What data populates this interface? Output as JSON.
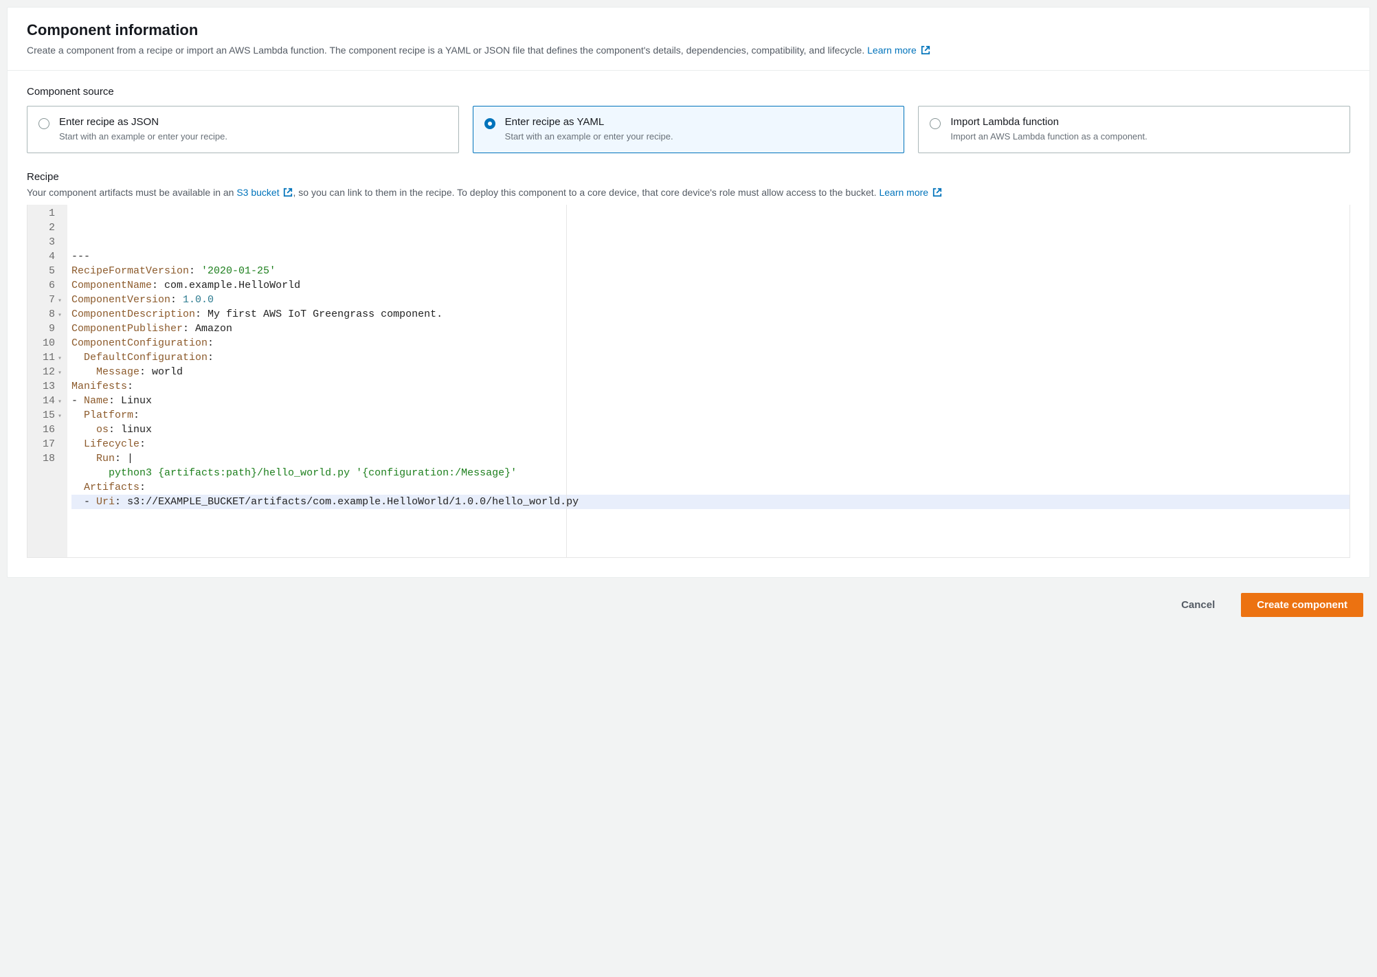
{
  "header": {
    "title": "Component information",
    "desc_part1": "Create a component from a recipe or import an AWS Lambda function. The component recipe is a YAML or JSON file that defines the component's details, dependencies, compatibility, and lifecycle. ",
    "learn_more": "Learn more"
  },
  "source": {
    "label": "Component source",
    "options": [
      {
        "id": "json",
        "title": "Enter recipe as JSON",
        "desc": "Start with an example or enter your recipe.",
        "selected": false
      },
      {
        "id": "yaml",
        "title": "Enter recipe as YAML",
        "desc": "Start with an example or enter your recipe.",
        "selected": true
      },
      {
        "id": "lambda",
        "title": "Import Lambda function",
        "desc": "Import an AWS Lambda function as a component.",
        "selected": false
      }
    ]
  },
  "recipe": {
    "label": "Recipe",
    "helper_pre": "Your component artifacts must be available in an ",
    "s3_link": "S3 bucket",
    "helper_mid": ", so you can link to them in the recipe. To deploy this component to a core device, that core device's role must allow access to the bucket. ",
    "learn_more": "Learn more",
    "lines": [
      {
        "n": "1",
        "fold": "",
        "tokens": [
          [
            "punct",
            "---"
          ]
        ]
      },
      {
        "n": "2",
        "fold": "",
        "tokens": [
          [
            "key",
            "RecipeFormatVersion"
          ],
          [
            "punct",
            ": "
          ],
          [
            "str",
            "'2020-01-25'"
          ]
        ]
      },
      {
        "n": "3",
        "fold": "",
        "tokens": [
          [
            "key",
            "ComponentName"
          ],
          [
            "punct",
            ": "
          ],
          [
            "plain",
            "com.example.HelloWorld"
          ]
        ]
      },
      {
        "n": "4",
        "fold": "",
        "tokens": [
          [
            "key",
            "ComponentVersion"
          ],
          [
            "punct",
            ": "
          ],
          [
            "num",
            "1.0.0"
          ]
        ]
      },
      {
        "n": "5",
        "fold": "",
        "tokens": [
          [
            "key",
            "ComponentDescription"
          ],
          [
            "punct",
            ": "
          ],
          [
            "plain",
            "My first AWS IoT Greengrass component."
          ]
        ]
      },
      {
        "n": "6",
        "fold": "",
        "tokens": [
          [
            "key",
            "ComponentPublisher"
          ],
          [
            "punct",
            ": "
          ],
          [
            "plain",
            "Amazon"
          ]
        ]
      },
      {
        "n": "7",
        "fold": "▾",
        "tokens": [
          [
            "key",
            "ComponentConfiguration"
          ],
          [
            "punct",
            ":"
          ]
        ]
      },
      {
        "n": "8",
        "fold": "▾",
        "tokens": [
          [
            "plain",
            "  "
          ],
          [
            "key",
            "DefaultConfiguration"
          ],
          [
            "punct",
            ":"
          ]
        ]
      },
      {
        "n": "9",
        "fold": "",
        "tokens": [
          [
            "plain",
            "    "
          ],
          [
            "key",
            "Message"
          ],
          [
            "punct",
            ": "
          ],
          [
            "plain",
            "world"
          ]
        ]
      },
      {
        "n": "10",
        "fold": "",
        "tokens": [
          [
            "key",
            "Manifests"
          ],
          [
            "punct",
            ":"
          ]
        ]
      },
      {
        "n": "11",
        "fold": "▾",
        "tokens": [
          [
            "punct",
            "- "
          ],
          [
            "key",
            "Name"
          ],
          [
            "punct",
            ": "
          ],
          [
            "plain",
            "Linux"
          ]
        ]
      },
      {
        "n": "12",
        "fold": "▾",
        "tokens": [
          [
            "plain",
            "  "
          ],
          [
            "key",
            "Platform"
          ],
          [
            "punct",
            ":"
          ]
        ]
      },
      {
        "n": "13",
        "fold": "",
        "tokens": [
          [
            "plain",
            "    "
          ],
          [
            "key",
            "os"
          ],
          [
            "punct",
            ": "
          ],
          [
            "plain",
            "linux"
          ]
        ]
      },
      {
        "n": "14",
        "fold": "▾",
        "tokens": [
          [
            "plain",
            "  "
          ],
          [
            "key",
            "Lifecycle"
          ],
          [
            "punct",
            ":"
          ]
        ]
      },
      {
        "n": "15",
        "fold": "▾",
        "tokens": [
          [
            "plain",
            "    "
          ],
          [
            "key",
            "Run"
          ],
          [
            "punct",
            ": |"
          ]
        ]
      },
      {
        "n": "16",
        "fold": "",
        "tokens": [
          [
            "plain",
            "      "
          ],
          [
            "str",
            "python3 {artifacts:path}/hello_world.py '{configuration:/Message}'"
          ]
        ]
      },
      {
        "n": "17",
        "fold": "",
        "tokens": [
          [
            "plain",
            "  "
          ],
          [
            "key",
            "Artifacts"
          ],
          [
            "punct",
            ":"
          ]
        ]
      },
      {
        "n": "18",
        "fold": "",
        "hl": true,
        "tokens": [
          [
            "plain",
            "  "
          ],
          [
            "punct",
            "- "
          ],
          [
            "key",
            "Uri"
          ],
          [
            "punct",
            ": "
          ],
          [
            "plain",
            "s3://EXAMPLE_BUCKET/artifacts/com.example.HelloWorld/1.0.0/hello_world.py"
          ]
        ]
      }
    ]
  },
  "footer": {
    "cancel": "Cancel",
    "create": "Create component"
  }
}
